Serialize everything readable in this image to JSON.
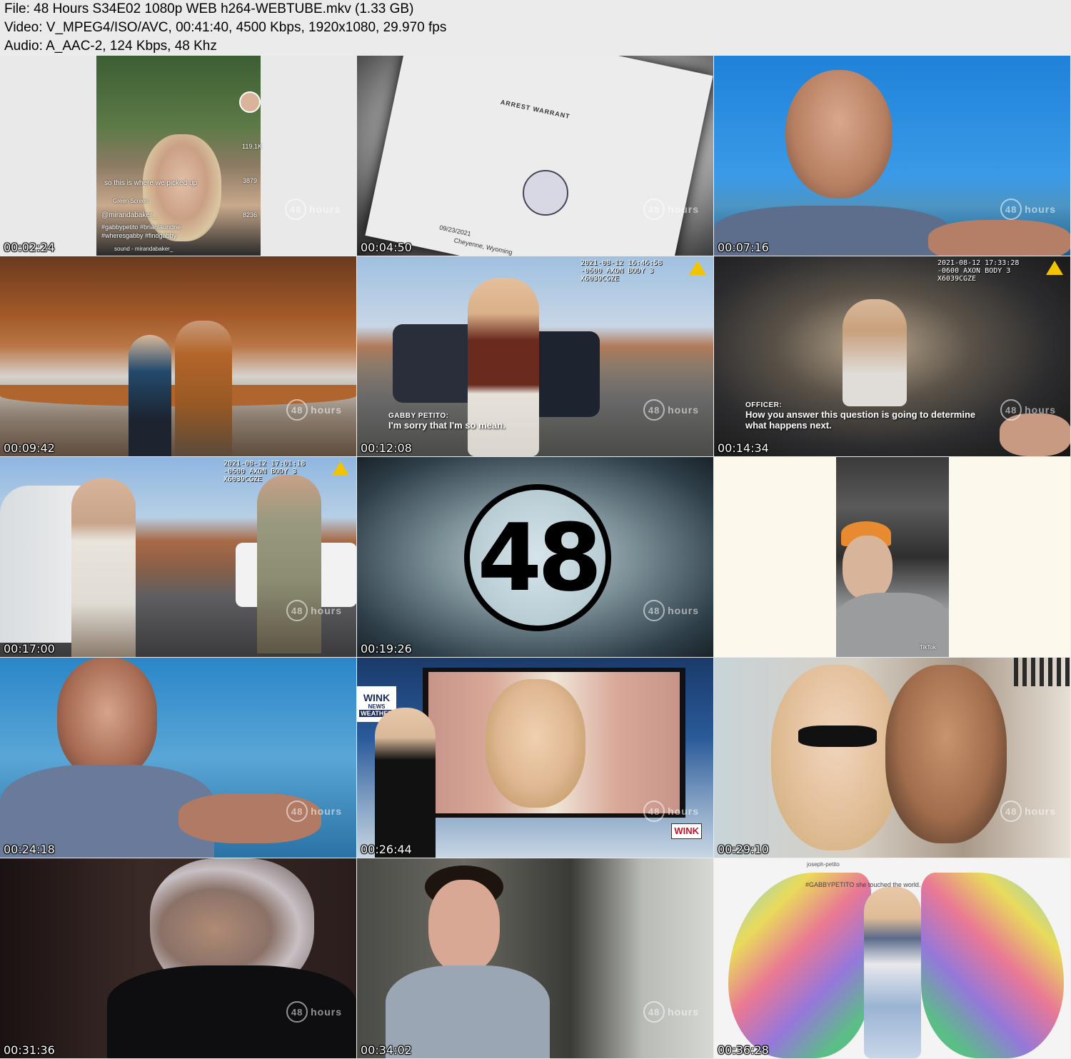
{
  "header": {
    "file_line": "File: 48 Hours S34E02 1080p WEB h264-WEBTUBE.mkv (1.33 GB)",
    "video_line": "Video: V_MPEG4/ISO/AVC, 00:41:40, 4500 Kbps, 1920x1080, 29.970 fps",
    "audio_line": "Audio: A_AAC-2, 124 Kbps, 48 Khz"
  },
  "watermark": {
    "number": "48",
    "word": "hours"
  },
  "tiles": [
    {
      "timestamp": "00:02:24",
      "caption_text": "so this is where we picked up",
      "user": "@mirandabaker_",
      "tags": "#gabbypetito #brianlaundrie #wheresgabby #findgabby",
      "sound": "sound - mirandabaker_",
      "likes": "119.1K",
      "comments": "3879",
      "shares": "8236",
      "filter": "Green Screen"
    },
    {
      "timestamp": "00:04:50",
      "doc_title": "ARREST WARRANT",
      "doc_city": "Cheyenne, Wyoming",
      "doc_date": "09/23/2021"
    },
    {
      "timestamp": "00:07:16"
    },
    {
      "timestamp": "00:09:42"
    },
    {
      "timestamp": "00:12:08",
      "axon": "2021-08-12 16:46:58 -0600 AXON BODY 3 X6039CGZE",
      "speaker": "GABBY PETITO:",
      "line1": "I'm sorry that I'm so mean.",
      "line2": ""
    },
    {
      "timestamp": "00:14:34",
      "axon": "2021-08-12 17:33:28 -0600 AXON BODY 3 X6039CGZE",
      "speaker": "OFFICER:",
      "line1": "How you answer this question is going to determine",
      "line2": "what happens next."
    },
    {
      "timestamp": "00:17:00",
      "axon": "2021-08-12 17:01:18 -0600 AXON BODY 3 X6039CGZE"
    },
    {
      "timestamp": "00:19:26",
      "logo": "48"
    },
    {
      "timestamp": "",
      "tiktok": "TikTok"
    },
    {
      "timestamp": "00:24:18"
    },
    {
      "timestamp": "00:26:44",
      "station": "WINK",
      "station2": "NEWS",
      "station3": "WEATHER",
      "bug": "WINK"
    },
    {
      "timestamp": "00:29:10"
    },
    {
      "timestamp": "00:31:36"
    },
    {
      "timestamp": "00:34:02"
    },
    {
      "timestamp": "00:36:28",
      "post_user": "joseph-petito",
      "post_text": "#GABBYPETITO she touched the world."
    }
  ],
  "colors": {
    "bg": "#ebebeb",
    "axon_yellow": "#f2c400",
    "wink_red": "#c8102e"
  }
}
